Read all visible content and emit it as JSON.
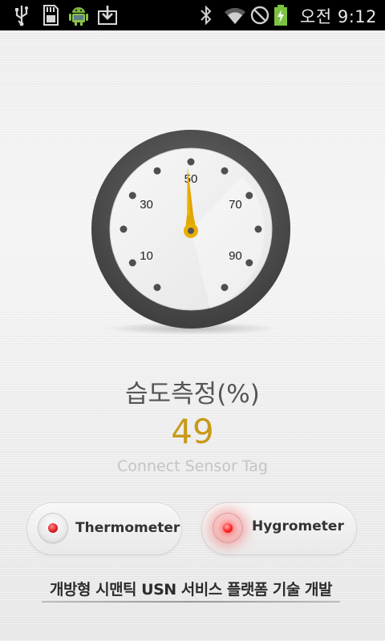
{
  "status_bar": {
    "time": "오전 9:12",
    "icons_left": [
      "usb-icon",
      "sd-card-icon",
      "android-icon",
      "download-icon"
    ],
    "icons_right": [
      "bluetooth-icon",
      "wifi-icon",
      "no-signal-icon",
      "battery-charging-icon"
    ]
  },
  "gauge": {
    "labels": [
      "10",
      "30",
      "50",
      "70",
      "90"
    ],
    "needle_value": 49,
    "colors": {
      "bezel": "#4a4a4a",
      "needle": "#e0a800"
    }
  },
  "measurement": {
    "title": "습도측정(%)",
    "value": "49",
    "status": "Connect Sensor Tag"
  },
  "modes": {
    "thermometer_label": "Thermometer",
    "hygrometer_label": "Hygrometer",
    "selected": "Hygrometer"
  },
  "footer": {
    "text": "개방형 시맨틱 USN 서비스 플랫폼 기술 개발"
  },
  "colors": {
    "value": "#c89a1a",
    "title": "#555555",
    "status": "#c4c4c4",
    "selected_indicator": "#ff2222"
  }
}
